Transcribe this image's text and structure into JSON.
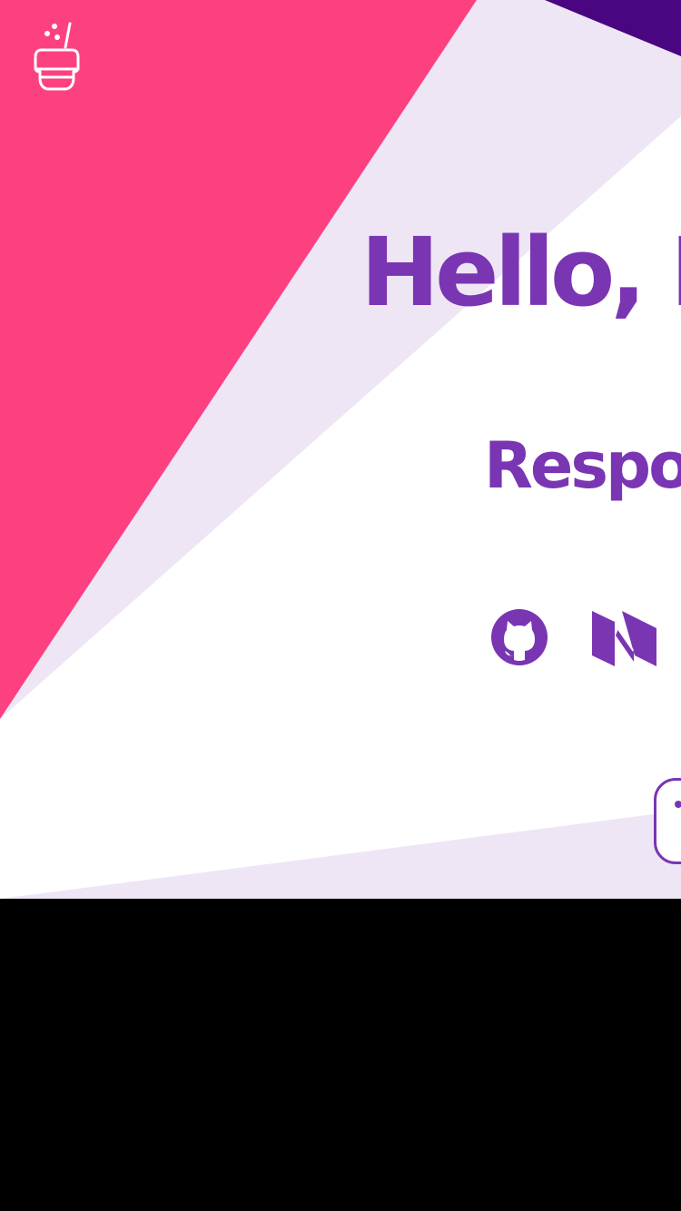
{
  "colors": {
    "pink": "#fd4180",
    "lavender": "#eee6f5",
    "deep_purple": "#4a0580",
    "purple_text": "#7a35b3",
    "white": "#ffffff",
    "letterbox": "#000000"
  },
  "brand": {
    "logo_icon": "honey-pot-icon"
  },
  "hero": {
    "heading": "Hello, I'n",
    "subheading": "Respon"
  },
  "social": [
    {
      "name": "github",
      "icon": "github-icon"
    },
    {
      "name": "medium",
      "icon": "medium-icon"
    }
  ]
}
